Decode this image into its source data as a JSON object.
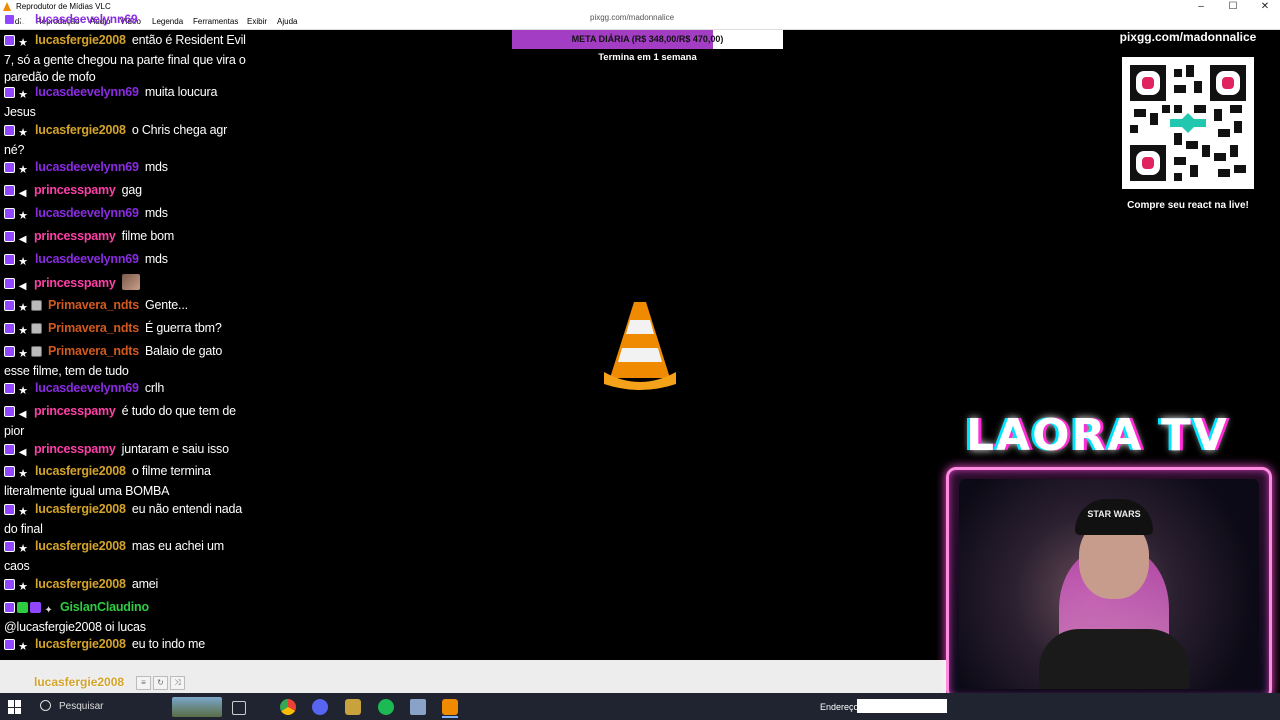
{
  "window": {
    "title": "Reprodutor de Mídias VLC",
    "controls": [
      "–",
      "☐",
      "✕"
    ]
  },
  "menubar": {
    "items": [
      "Mídia",
      "Reprodução",
      "Áudio",
      "Vídeo",
      "Legenda",
      "Ferramentas",
      "Exibir",
      "Ajuda"
    ]
  },
  "chat": {
    "top_partial_user": "lucasdeevelynn69",
    "messages": [
      {
        "user": "lucasfergie2008",
        "text": "então é Resident Evil 7, só a gente chegou na parte final que vira o paredão de mofo"
      },
      {
        "user": "lucasdeevelynn69",
        "text": "muita loucura Jesus"
      },
      {
        "user": "lucasfergie2008",
        "text": "o Chris chega agr né?"
      },
      {
        "user": "lucasdeevelynn69",
        "text": "mds"
      },
      {
        "user": "princesspamy",
        "text": "gag"
      },
      {
        "user": "lucasdeevelynn69",
        "text": "mds"
      },
      {
        "user": "princesspamy",
        "text": "filme bom"
      },
      {
        "user": "lucasdeevelynn69",
        "text": "mds"
      },
      {
        "user": "princesspamy",
        "text": ""
      },
      {
        "user": "Primavera_ndts",
        "text": "Gente..."
      },
      {
        "user": "Primavera_ndts",
        "text": "É guerra tbm?"
      },
      {
        "user": "Primavera_ndts",
        "text": "Balaio de gato esse filme, tem de tudo"
      },
      {
        "user": "lucasdeevelynn69",
        "text": "crlh"
      },
      {
        "user": "princesspamy",
        "text": "é tudo do que tem de pior"
      },
      {
        "user": "princesspamy",
        "text": "juntaram e saiu isso"
      },
      {
        "user": "lucasfergie2008",
        "text": "o filme termina literalmente igual uma BOMBA"
      },
      {
        "user": "lucasfergie2008",
        "text": "eu não entendi nada do final"
      },
      {
        "user": "lucasfergie2008",
        "text": "mas eu achei um caos"
      },
      {
        "user": "lucasfergie2008",
        "text": "amei"
      },
      {
        "user": "GislanClaudino",
        "text": "@lucasfergie2008 oi lucas"
      },
      {
        "user": "lucasfergie2008",
        "text": "eu to indo me"
      }
    ],
    "bottom_partial_user": "lucasfergie2008"
  },
  "goal": {
    "caption": "pixgg.com/madonnalice",
    "label": "META DIÁRIA (R$ 348,00/R$ 470,00)",
    "progress": 0.74,
    "ends": "Termina em 1 semana"
  },
  "qr": {
    "url": "pixgg.com/madonnalice",
    "caption": "Compre seu react na live!"
  },
  "logo": {
    "text": "LAORA TV"
  },
  "webcam": {
    "beanie_text": "STAR WARS"
  },
  "taskbar": {
    "search_placeholder": "Pesquisar",
    "address_label": "Endereço"
  },
  "colors": {
    "sub_purple": "#9146ff",
    "goal_fill": "#a33dc3",
    "vlc_orange": "#f08a00",
    "frame_pink": "#ff8be0"
  }
}
